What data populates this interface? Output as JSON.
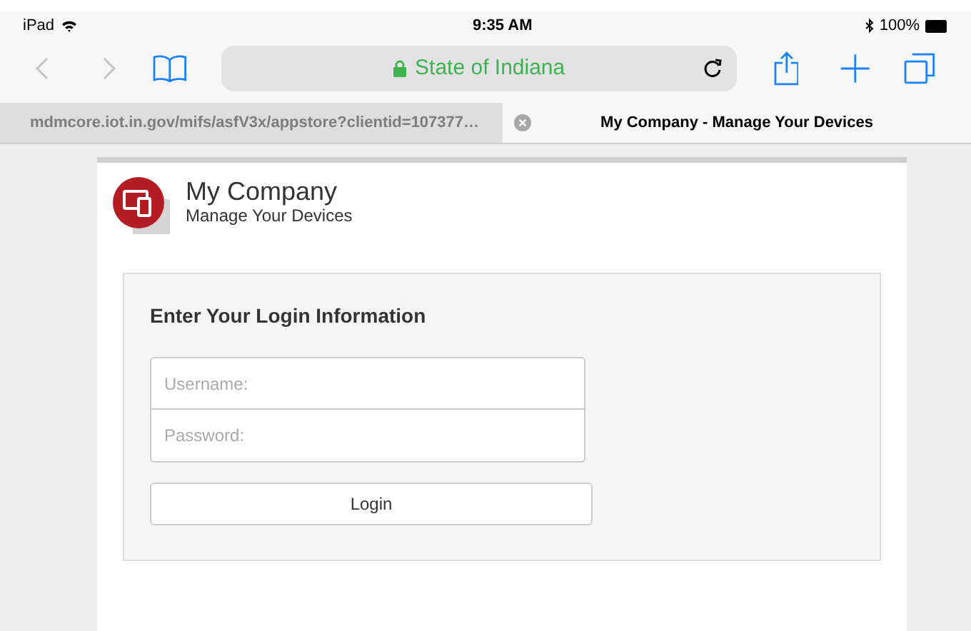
{
  "status_bar": {
    "device": "iPad",
    "time": "9:35 AM",
    "battery": "100%"
  },
  "address_bar": {
    "text": "State of Indiana",
    "secure": true
  },
  "tabs": [
    {
      "label": "mdmcore.iot.in.gov/mifs/asfV3x/appstore?clientid=107377…",
      "selected": false
    },
    {
      "label": "My Company - Manage Your Devices",
      "selected": true
    }
  ],
  "header": {
    "title": "My Company",
    "subtitle": "Manage Your Devices"
  },
  "login": {
    "heading": "Enter Your Login Information",
    "username": {
      "placeholder": "Username:"
    },
    "password": {
      "placeholder": "Password:"
    },
    "button": "Login"
  }
}
